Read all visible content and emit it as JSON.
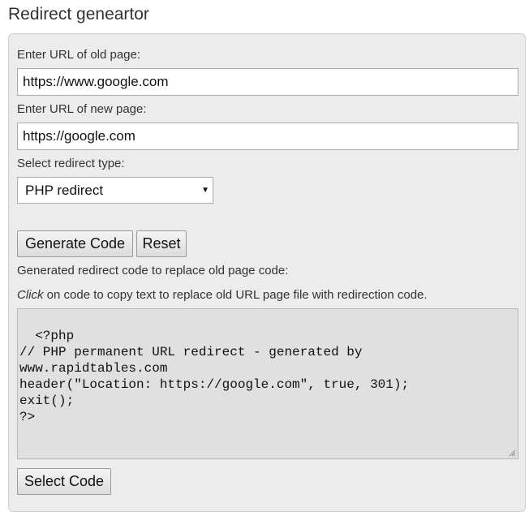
{
  "page": {
    "title": "Redirect geneartor"
  },
  "form": {
    "old_url_label": "Enter URL of old page:",
    "old_url_value": "https://www.google.com",
    "new_url_label": "Enter URL of new page:",
    "new_url_value": "https://google.com",
    "redirect_type_label": "Select redirect type:",
    "redirect_type_selected": "PHP redirect",
    "generate_label": "Generate Code",
    "reset_label": "Reset"
  },
  "output": {
    "heading": "Generated redirect code to replace old page code:",
    "hint_click": "Click",
    "hint_rest": " on code to copy text to replace old URL page file with redirection code.",
    "code": "<?php\n// PHP permanent URL redirect - generated by\nwww.rapidtables.com\nheader(\"Location: https://google.com\", true, 301);\nexit();\n?>",
    "select_code_label": "Select Code"
  },
  "icons": {
    "select_arrow": "triangle-down-icon",
    "resize": "resize-grip-icon"
  }
}
